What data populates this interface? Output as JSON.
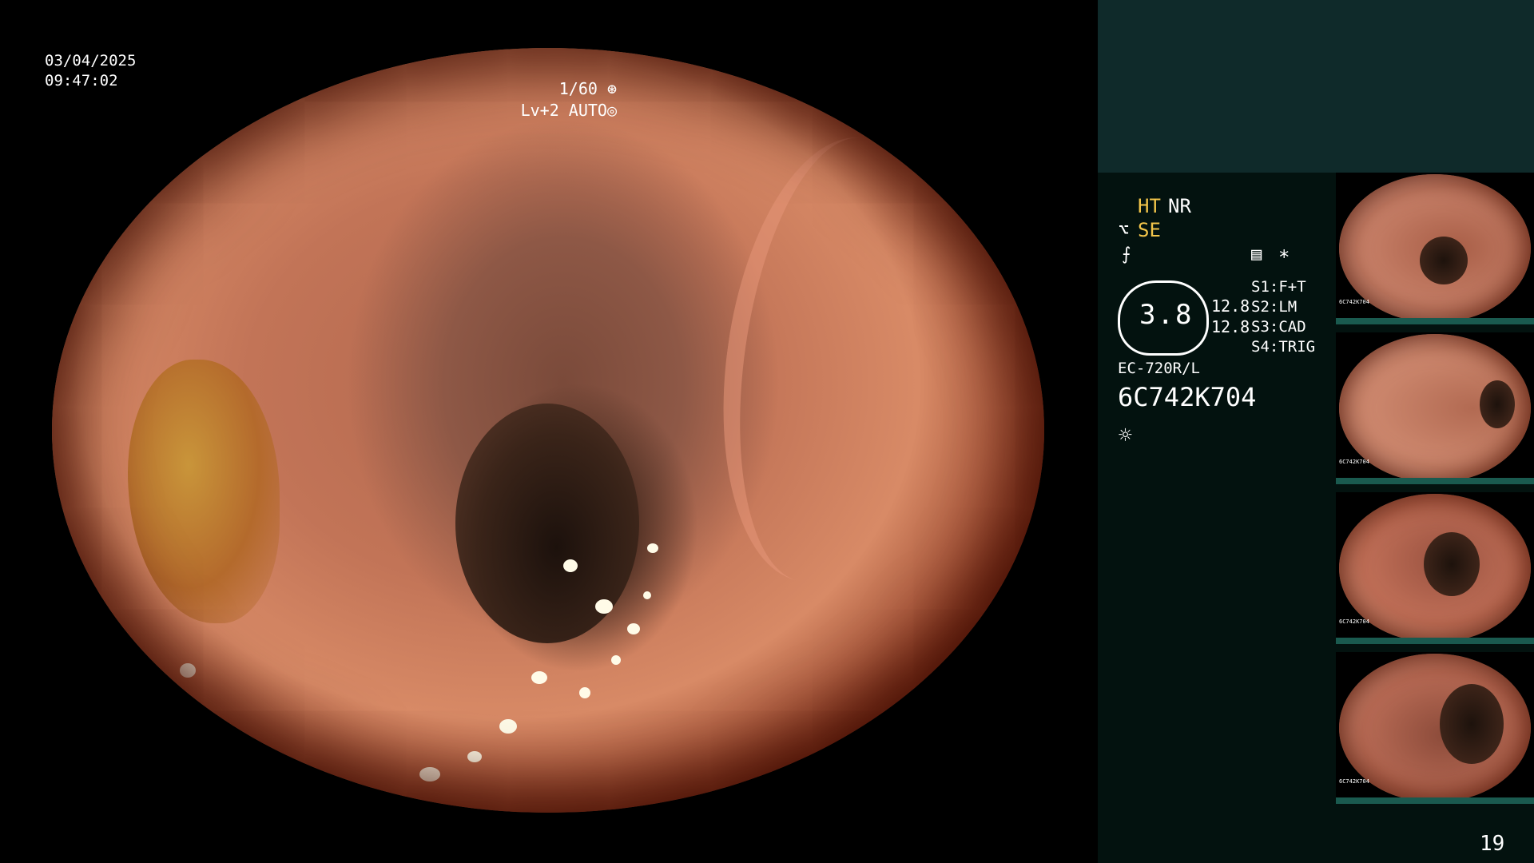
{
  "overlay": {
    "date": "03/04/2025",
    "time": "09:47:02",
    "shutter": "1/60",
    "level": "Lv+2 AUTO"
  },
  "side_panel": {
    "ht": "HT",
    "nr": "NR",
    "se": "SE",
    "gauge_value": "3.8",
    "zoom_a": "12.8",
    "zoom_b": "12.8",
    "s1": "S1:F+T",
    "s2": "S2:LM",
    "s3": "S3:CAD",
    "s4": "S4:TRIG",
    "scope_model": "EC-720R/L",
    "serial": "6C742K704",
    "asterisk": "*",
    "icons": [
      "scope-icon",
      "settings-icon",
      "menu-icon",
      "light-icon"
    ],
    "thumbnail_label": "6C742K704"
  },
  "page_number": "19",
  "colors": {
    "accent_yellow": "#f2c44a",
    "panel_bg": "#03120f",
    "panel_top": "#0f2a2a",
    "thumb_strip": "#1a5a4f"
  }
}
